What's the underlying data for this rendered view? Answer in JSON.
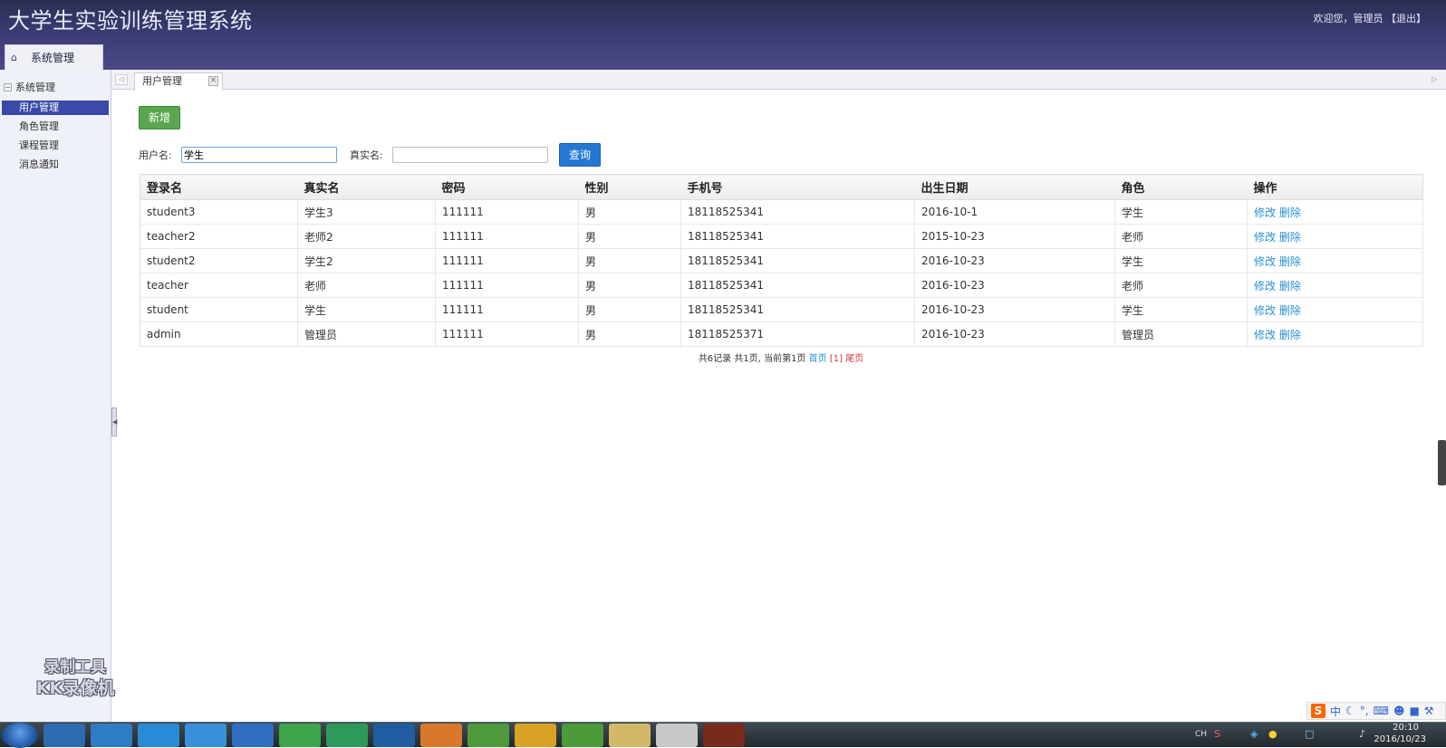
{
  "header": {
    "app_title": "大学生实验训练管理系统",
    "welcome": "欢迎您，管理员 【退出】"
  },
  "top_tab": {
    "label": "系统管理"
  },
  "sidebar": {
    "group_label": "系统管理",
    "items": [
      {
        "label": "用户管理",
        "active": true
      },
      {
        "label": "角色管理",
        "active": false
      },
      {
        "label": "课程管理",
        "active": false
      },
      {
        "label": "消息通知",
        "active": false
      }
    ]
  },
  "tabs": [
    {
      "label": "用户管理"
    }
  ],
  "toolbar": {
    "new_label": "新增",
    "search_label": "查询"
  },
  "search": {
    "username_label": "用户名:",
    "username_value": "学生",
    "realname_label": "真实名:",
    "realname_value": ""
  },
  "table": {
    "columns": [
      "登录名",
      "真实名",
      "密码",
      "性别",
      "手机号",
      "出生日期",
      "角色",
      "操作"
    ],
    "rows": [
      {
        "login": "student3",
        "real": "学生3",
        "password": "111111",
        "gender": "男",
        "phone": "18118525341",
        "birth": "2016-10-1",
        "role": "学生"
      },
      {
        "login": "teacher2",
        "real": "老师2",
        "password": "111111",
        "gender": "男",
        "phone": "18118525341",
        "birth": "2015-10-23",
        "role": "老师"
      },
      {
        "login": "student2",
        "real": "学生2",
        "password": "111111",
        "gender": "男",
        "phone": "18118525341",
        "birth": "2016-10-23",
        "role": "学生"
      },
      {
        "login": "teacher",
        "real": "老师",
        "password": "111111",
        "gender": "男",
        "phone": "18118525341",
        "birth": "2016-10-23",
        "role": "老师"
      },
      {
        "login": "student",
        "real": "学生",
        "password": "111111",
        "gender": "男",
        "phone": "18118525341",
        "birth": "2016-10-23",
        "role": "学生"
      },
      {
        "login": "admin",
        "real": "管理员",
        "password": "111111",
        "gender": "男",
        "phone": "18118525371",
        "birth": "2016-10-23",
        "role": "管理员"
      }
    ],
    "edit_label": "修改",
    "delete_label": "删除"
  },
  "pager": {
    "summary": "共6记录 共1页, 当前第1页",
    "first": "首页",
    "current": "[1]",
    "last": "尾页"
  },
  "watermark": {
    "line1": "录制工具",
    "line2": "KK录像机"
  },
  "ime": {
    "label": "中"
  },
  "taskbar": {
    "lang": "CH",
    "time": "20:10",
    "date": "2016/10/23"
  },
  "colors": {
    "header": "#3b3a73",
    "active_nav": "#3b4aa8",
    "new_button": "#5aa64f",
    "search_button": "#2478d4",
    "link": "#2a8fd4"
  }
}
